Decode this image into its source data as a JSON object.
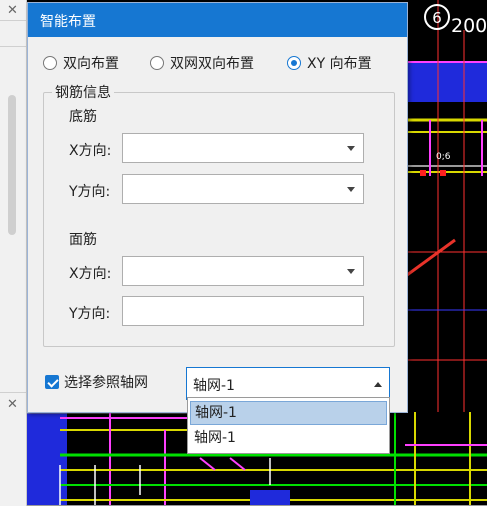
{
  "dialog": {
    "title": "智能布置",
    "layout_options": [
      {
        "label": "双向布置",
        "selected": false
      },
      {
        "label": "双网双向布置",
        "selected": false
      },
      {
        "label": "XY 向布置",
        "selected": true
      }
    ],
    "rebar_group": {
      "title": "钢筋信息",
      "bottom_title": "底筋",
      "top_title": "面筋",
      "x_label": "X方向:",
      "y_label": "Y方向:",
      "bottom_x_value": "",
      "bottom_y_value": "",
      "top_x_value": "",
      "top_y_value": ""
    },
    "reference_axis": {
      "checkbox_label": "选择参照轴网",
      "checked": true,
      "selected_value": "轴网-1",
      "options": [
        "轴网-1",
        "轴网-1"
      ],
      "highlighted_index": 0
    }
  },
  "cad": {
    "grid_number": "6",
    "dimension_text": "200",
    "small_dimension": "0;6"
  },
  "colors": {
    "title_bar": "#1677d2",
    "arrow": "#e8332a",
    "cad_background": "#000000"
  },
  "icons": {
    "close": "close-icon",
    "dropdown_arrow": "chevron-down-icon",
    "dropdown_open": "chevron-up-icon"
  }
}
